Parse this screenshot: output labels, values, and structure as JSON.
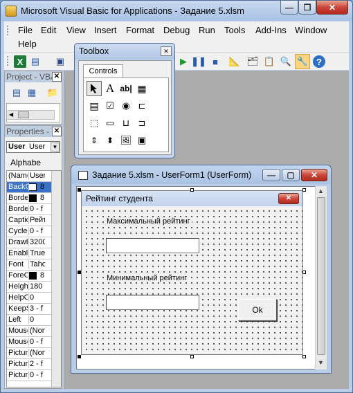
{
  "window": {
    "title": "Microsoft Visual Basic for Applications - Задание 5.xlsm"
  },
  "menu": [
    "File",
    "Edit",
    "View",
    "Insert",
    "Format",
    "Debug",
    "Run",
    "Tools",
    "Add-Ins",
    "Window",
    "Help"
  ],
  "project_panel": {
    "title": "Project - VBA"
  },
  "properties_panel": {
    "title": "Properties - U",
    "object_name": "User",
    "object_type": "User",
    "tab": "Alphabe",
    "rows": [
      {
        "name": "(Name",
        "value": "User"
      },
      {
        "name": "BackC",
        "value": "8"
      },
      {
        "name": "Borde",
        "value": "8"
      },
      {
        "name": "Borde",
        "value": "0 - f"
      },
      {
        "name": "Captic",
        "value": "Рейт"
      },
      {
        "name": "Cycle",
        "value": "0 - f"
      },
      {
        "name": "DrawB",
        "value": "3200"
      },
      {
        "name": "Enable",
        "value": "True"
      },
      {
        "name": "Font",
        "value": "Taho"
      },
      {
        "name": "ForeC",
        "value": "8"
      },
      {
        "name": "Heigh",
        "value": "180"
      },
      {
        "name": "HelpC",
        "value": "0"
      },
      {
        "name": "KeepS",
        "value": "3 - f"
      },
      {
        "name": "Left",
        "value": "0"
      },
      {
        "name": "Mouse",
        "value": "(Non"
      },
      {
        "name": "Mouse",
        "value": "0 - f"
      },
      {
        "name": "Pictur",
        "value": "(Non"
      },
      {
        "name": "Pictur",
        "value": "2 - f"
      },
      {
        "name": "Pictur",
        "value": "0 - f"
      }
    ]
  },
  "toolbox": {
    "title": "Toolbox",
    "tab": "Controls"
  },
  "designer": {
    "title": "Задание 5.xlsm - UserForm1 (UserForm)",
    "form_caption": "Рейтинг студента",
    "label_max": "Максимальный рейтинг",
    "label_min": "Минимальный рейтинг",
    "ok_button": "Ok",
    "input_max_value": "",
    "input_min_value": ""
  }
}
